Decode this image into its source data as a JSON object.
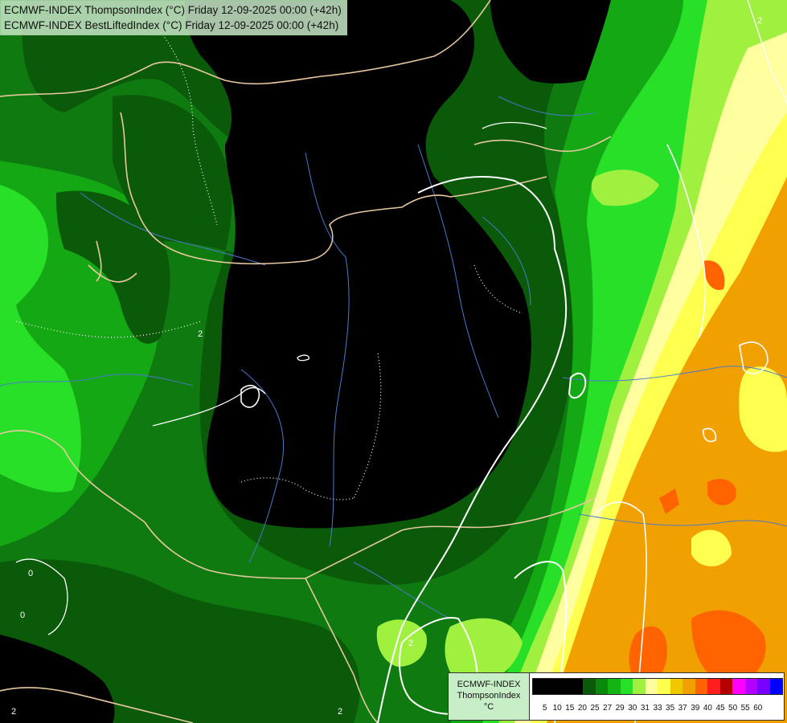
{
  "title": {
    "line1": "ECMWF-INDEX ThompsonIndex (°C) Friday 12-09-2025 00:00 (+42h)",
    "line2": "ECMWF-INDEX BestLiftedIndex (°C) Friday 12-09-2025 00:00 (+42h)"
  },
  "legend": {
    "model": "ECMWF-INDEX",
    "parameter": "ThompsonIndex",
    "unit": "°C",
    "colors": [
      "#000000",
      "#000000",
      "#000000",
      "#000000",
      "#0a5a0a",
      "#0a8a0a",
      "#14b414",
      "#28e028",
      "#a0f040",
      "#ffffa0",
      "#ffff50",
      "#f0c800",
      "#f0a000",
      "#ff6400",
      "#ff1e1e",
      "#b40000",
      "#ff00ff",
      "#b400ff",
      "#7800ff",
      "#0000ff"
    ],
    "ticks": [
      "5",
      "10",
      "15",
      "20",
      "25",
      "27",
      "29",
      "30",
      "31",
      "33",
      "35",
      "37",
      "39",
      "40",
      "45",
      "50",
      "55",
      "60"
    ]
  },
  "contour_labels": [
    "2",
    "2",
    "0",
    "0",
    "2",
    "2",
    "2"
  ],
  "colors": {
    "black": "#000000",
    "dark_green": "#0a5a0a",
    "mid_green": "#0f7a0f",
    "green": "#14a814",
    "bright_green": "#28e028",
    "lime": "#a0f040",
    "pale_yellow": "#ffffa0",
    "yellow": "#ffff50",
    "orange": "#f0a000",
    "orange_red": "#ff6400",
    "border": "#e8c8a0",
    "river": "#4a7ac8"
  }
}
